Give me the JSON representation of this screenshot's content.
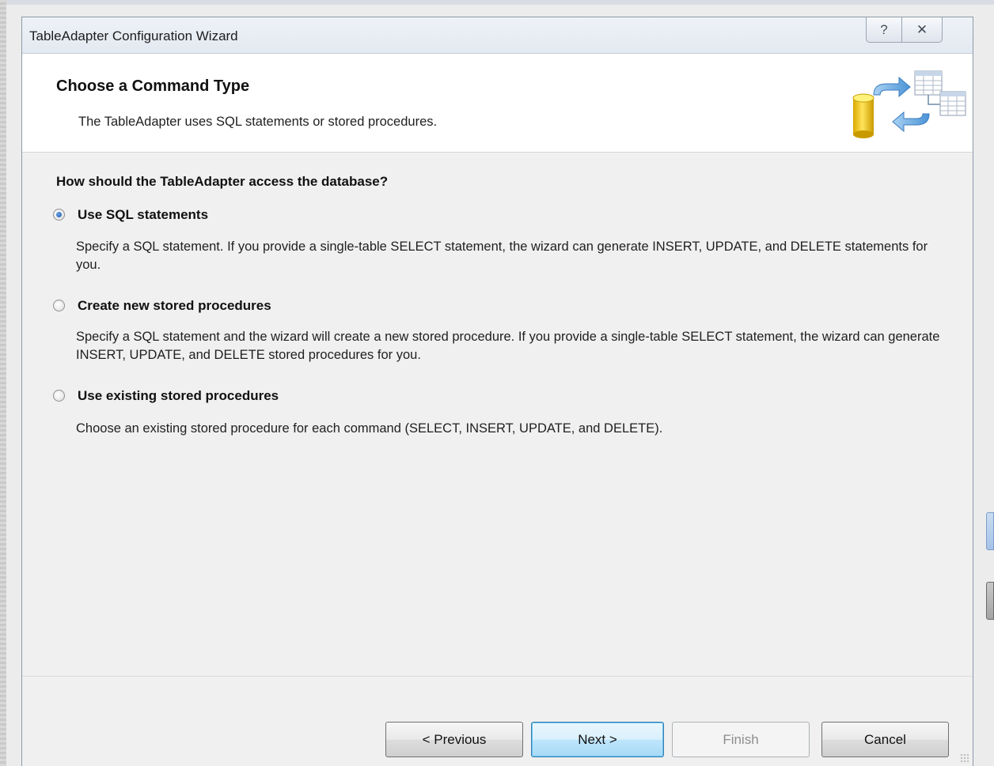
{
  "window": {
    "title": "TableAdapter Configuration Wizard",
    "help_glyph": "?",
    "close_glyph": "✕"
  },
  "header": {
    "title": "Choose a Command Type",
    "subtitle": "The TableAdapter uses SQL statements or stored procedures.",
    "icon": "database-tables-icon"
  },
  "question": "How should the TableAdapter access the database?",
  "options": [
    {
      "label": "Use SQL statements",
      "selected": true,
      "description": "Specify a SQL statement. If you provide a single-table SELECT statement, the wizard can generate INSERT, UPDATE, and DELETE statements for you."
    },
    {
      "label": "Create new stored procedures",
      "selected": false,
      "description": "Specify a SQL statement and the wizard will create a new stored procedure. If you provide a single-table SELECT statement, the wizard can generate INSERT, UPDATE, and DELETE stored procedures for you."
    },
    {
      "label": "Use existing stored procedures",
      "selected": false,
      "description": "Choose an existing stored procedure for each command (SELECT, INSERT, UPDATE, and DELETE)."
    }
  ],
  "buttons": {
    "previous": "< Previous",
    "next": "Next >",
    "finish": "Finish",
    "cancel": "Cancel"
  },
  "colors": {
    "accent": "#3c7fb1",
    "dialog_bg": "#f0f0f0",
    "header_bg": "#ffffff"
  }
}
